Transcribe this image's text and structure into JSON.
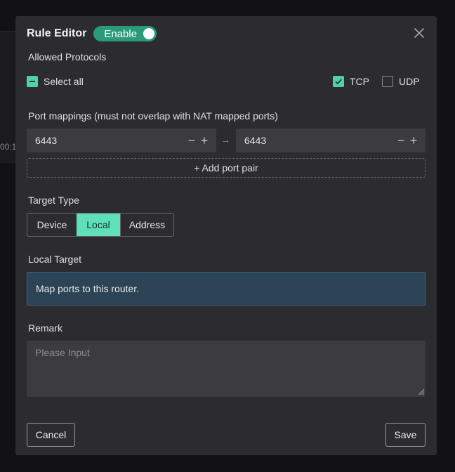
{
  "background": {
    "time_fragment": "00:1"
  },
  "header": {
    "title": "Rule Editor",
    "enable_label": "Enable",
    "enabled": true,
    "close_icon": "close-icon"
  },
  "protocols": {
    "label": "Allowed Protocols",
    "select_all": {
      "label": "Select all",
      "state": "indeterminate"
    },
    "tcp": {
      "label": "TCP",
      "checked": true
    },
    "udp": {
      "label": "UDP",
      "checked": false
    }
  },
  "ports": {
    "label": "Port mappings (must not overlap with NAT mapped ports)",
    "from_value": "6443",
    "to_value": "6443",
    "minus": "−",
    "plus": "+",
    "arrow": "→",
    "add_pair_label": "+ Add port pair"
  },
  "target_type": {
    "label": "Target Type",
    "options": [
      "Device",
      "Local",
      "Address"
    ],
    "selected": "Local"
  },
  "local_target": {
    "label": "Local Target",
    "text": "Map ports to this router."
  },
  "remark": {
    "label": "Remark",
    "placeholder": "Please Input",
    "value": ""
  },
  "footer": {
    "cancel_label": "Cancel",
    "save_label": "Save"
  },
  "colors": {
    "accent": "#4fd1ac",
    "toggle_on": "#2a9a7a",
    "info_bg": "#2b4456",
    "modal_bg": "#2c2c30"
  }
}
